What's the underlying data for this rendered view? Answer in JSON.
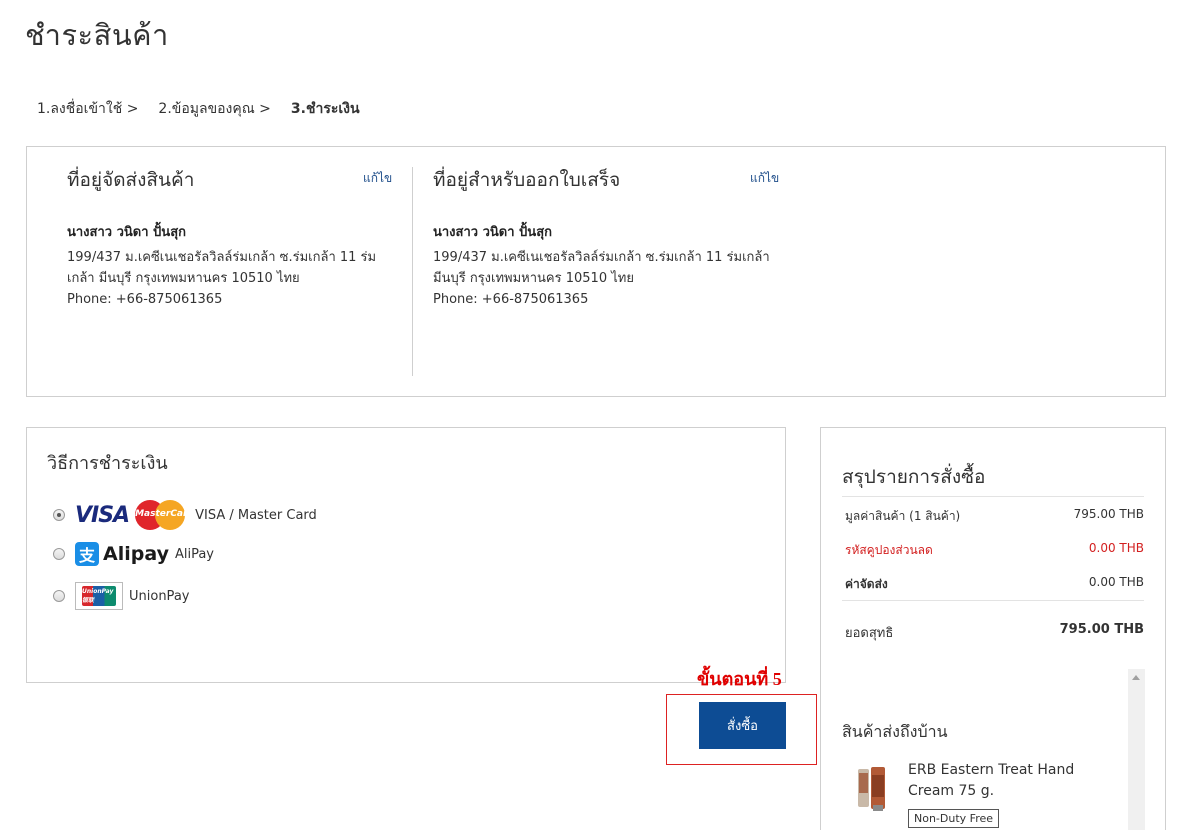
{
  "page": {
    "title": "ชำระสินค้า"
  },
  "breadcrumb": [
    {
      "label": "1.ลงชื่อเข้าใช้ >"
    },
    {
      "label": "2.ข้อมูลของคุณ >"
    },
    {
      "label": "3.ชำระเงิน"
    }
  ],
  "shipping": {
    "title": "ที่อยู่จัดส่งสินค้า",
    "edit_label": "แก้ไข",
    "name": "นางสาว วนิดา ปั้นสุก",
    "line1": "199/437 ม.เคซีเนเชอรัลวิลล์ร่มเกล้า ซ.ร่มเกล้า 11 ร่ม",
    "line2": "เกล้า มีนบุรี กรุงเทพมหานคร 10510 ไทย",
    "phone": "Phone: +66-875061365"
  },
  "billing": {
    "title": "ที่อยู่สำหรับออกใบเสร็จ",
    "edit_label": "แก้ไข",
    "name": "นางสาว วนิดา ปั้นสุก",
    "line1": "199/437 ม.เคซีเนเชอรัลวิลล์ร่มเกล้า ซ.ร่มเกล้า 11 ร่มเกล้า",
    "line2": "มีนบุรี กรุงเทพมหานคร 10510 ไทย",
    "phone": "Phone: +66-875061365"
  },
  "payment": {
    "title": "วิธีการชำระเงิน",
    "options": [
      {
        "label": "VISA / Master Card",
        "logo_text": "VISA",
        "logo2_text": "MasterCard",
        "selected": true
      },
      {
        "label": "AliPay",
        "logo_text": "Alipay",
        "icon_glyph": "支",
        "selected": false
      },
      {
        "label": "UnionPay",
        "logo_text": "UnionPay 银联",
        "selected": false
      }
    ]
  },
  "step": {
    "label": "ขั้นตอนที่ 5"
  },
  "order_button": {
    "label": "สั่งซื้อ"
  },
  "summary": {
    "title": "สรุปรายการสั่งซื้อ",
    "rows": [
      {
        "label": "มูลค่าสินค้า (1 สินค้า)",
        "value": "795.00 THB"
      },
      {
        "label": "รหัสคูปองส่วนลด",
        "value": "0.00 THB"
      },
      {
        "label": "ค่าจัดส่ง",
        "value": "0.00 THB"
      },
      {
        "label": "ยอดสุทธิ",
        "value": "795.00 THB"
      }
    ],
    "delivery_title": "สินค้าส่งถึงบ้าน",
    "product": {
      "name": "ERB Eastern Treat Hand Cream 75 g.",
      "badge": "Non-Duty Free"
    }
  },
  "colors": {
    "primary_button": "#0d4c94",
    "link": "#1f4e8a",
    "discount": "#d32020",
    "annotation": "#e00000"
  }
}
